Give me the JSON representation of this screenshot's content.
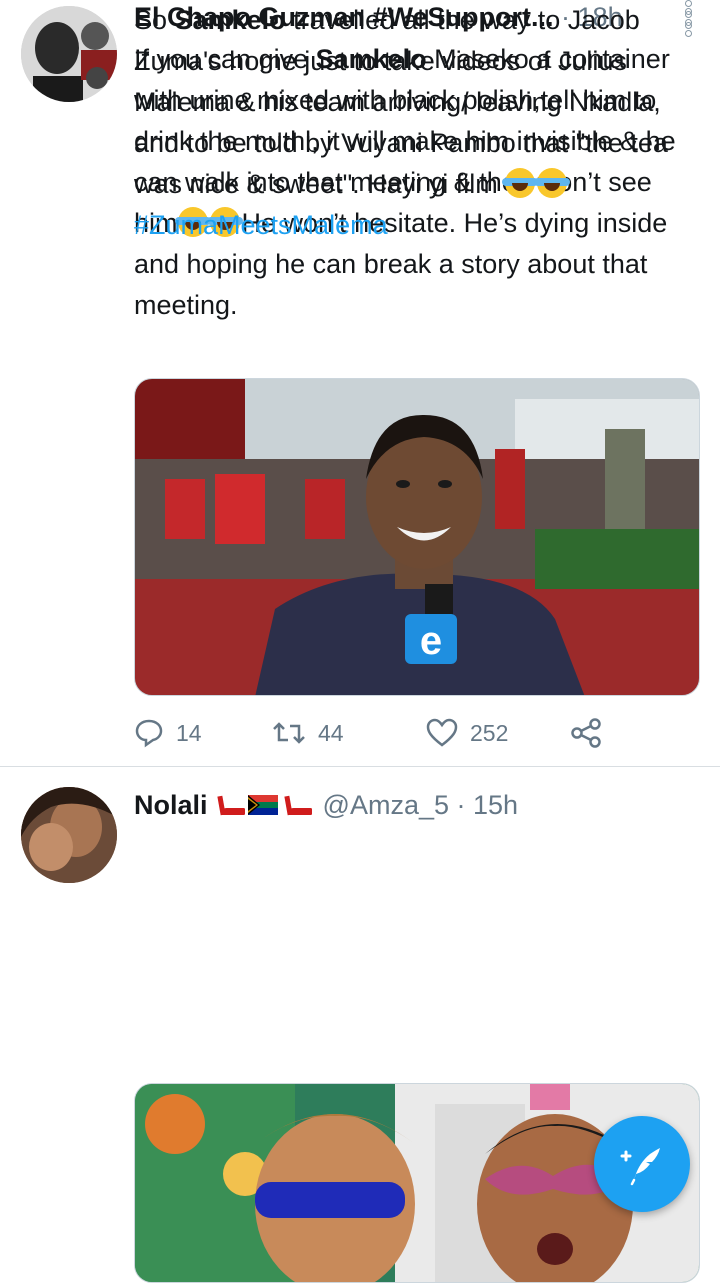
{
  "tweets": [
    {
      "name": "El Chapo Guzman #WeSupport...",
      "handle": "",
      "time": "· 18h",
      "text": {
        "t1": "If you can give ",
        "b1": "Samkelo",
        "t2": " Maseko a container with urine mixed with black polish,tell him to drink the muthi, it will make him invisible & he can walk into that meeting & they won’t see him",
        "t3": "He won’t hesitate. He’s dying inside and hoping he can break a story about that meeting."
      },
      "media": {
        "mic_letter": "e"
      },
      "actions": {
        "reply": "14",
        "retweet": "44",
        "like": "252"
      }
    },
    {
      "name": "Nolali",
      "handle": "@Amza_5",
      "time": "· 15h",
      "text": {
        "t1": "So ",
        "b1": "Samkelo",
        "t2": " travelled all the way to Jacob Zuma's home just to take videos of Julius Malema & his team arriving/ leaving Nkadla, and to be told by Vuyani Pambo that \"the tea was nice & sweet\". Hayi yi film ",
        "hashtag": "#ZumaMeetsMalema"
      }
    }
  ],
  "icons": {
    "reply": "reply-icon",
    "retweet": "retweet-icon",
    "like": "heart-icon",
    "share": "share-icon",
    "more": "more-vertical-icon",
    "compose": "compose-tweet-icon"
  },
  "colors": {
    "accent": "#1da1f2",
    "meta": "#657786"
  }
}
